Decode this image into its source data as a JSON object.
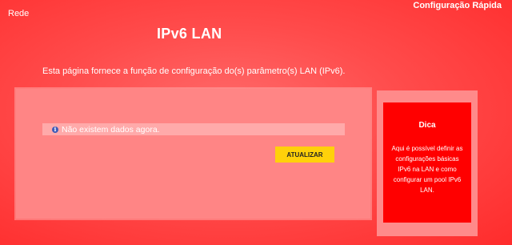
{
  "nav": {
    "left_link": "Rede",
    "right_link": "Configuração Rápida"
  },
  "page": {
    "title": "IPv6 LAN",
    "description": "Esta página fornece a função de configuração do(s) parâmetro(s) LAN (IPv6)."
  },
  "panel": {
    "info_icon": "info-icon",
    "info_message": "Não existem dados agora.",
    "refresh_label": "ATUALIZAR"
  },
  "tip": {
    "title": "Dica",
    "text": "Aqui é possível definir as configurações básicas IPv6 na LAN e como configurar um pool IPv6 LAN."
  },
  "colors": {
    "background": "#ff4b4b",
    "panel": "#ff8585",
    "info_bar": "#ffaaaa",
    "button": "#ffd10a",
    "tip_box": "#ff0000",
    "info_icon": "#3f5bb8"
  }
}
